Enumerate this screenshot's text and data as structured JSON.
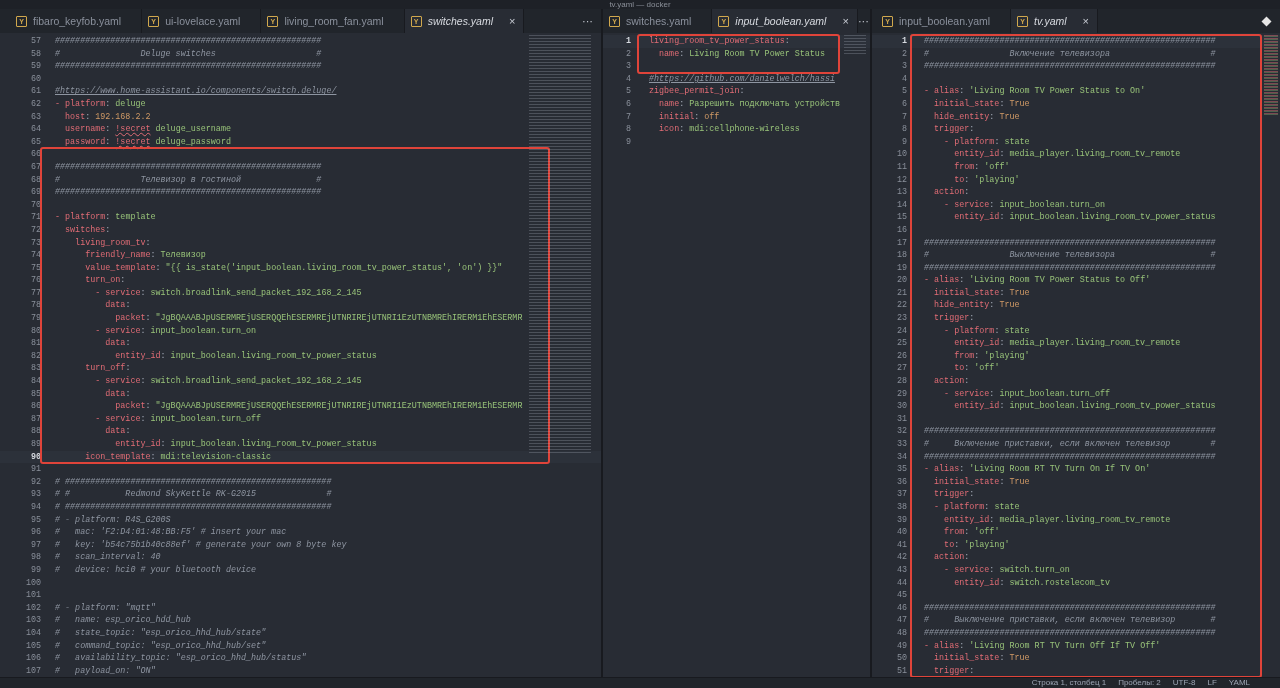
{
  "window": {
    "title": "tv.yaml — docker"
  },
  "panes": [
    {
      "tabs": [
        {
          "badge": "Y",
          "label": "fibaro_keyfob.yaml",
          "selected": false
        },
        {
          "badge": "Y",
          "label": "ui-lovelace.yaml",
          "selected": false
        },
        {
          "badge": "Y",
          "label": "living_room_fan.yaml",
          "selected": false
        },
        {
          "badge": "Y",
          "label": "switches.yaml",
          "selected": true,
          "close": "×"
        }
      ],
      "more": "···",
      "blocks": [
        {
          "boxed": false,
          "lines": [
            {
              "n": "57",
              "kind": "comment",
              "text": "#####################################################",
              "current": false
            },
            {
              "n": "58",
              "kind": "comment",
              "text": "#                Deluge switches                    #",
              "current": false
            },
            {
              "n": "59",
              "kind": "comment",
              "text": "#####################################################",
              "current": false
            },
            {
              "n": "60",
              "kind": "blank",
              "current": false
            },
            {
              "n": "61",
              "kind": "link",
              "text": "#https://www.home-assistant.io/components/switch.deluge/",
              "current": false
            },
            {
              "n": "62",
              "kind": "code",
              "lead": "- ",
              "key": "platform",
              "sep": ": ",
              "value": "deluge",
              "current": false
            },
            {
              "n": "63",
              "kind": "code",
              "key": "  host",
              "sep": ": ",
              "value": "192.168.2.2",
              "const": true,
              "current": false
            },
            {
              "n": "64",
              "kind": "code",
              "key": "  username",
              "sep": ": ",
              "tag": "!secret",
              "value": " deluge_username",
              "current": false
            },
            {
              "n": "65",
              "kind": "code",
              "key": "  password",
              "sep": ": ",
              "tag": "!secret",
              "value": " deluge_password",
              "current": false
            }
          ]
        },
        {
          "boxed": true,
          "lines": [
            {
              "n": "66",
              "kind": "blank",
              "current": false
            },
            {
              "n": "67",
              "kind": "comment",
              "text": "#####################################################",
              "current": false
            },
            {
              "n": "68",
              "kind": "comment",
              "text": "#                Телевизор в гостиной               #",
              "current": false
            },
            {
              "n": "69",
              "kind": "comment",
              "text": "#####################################################",
              "current": false
            },
            {
              "n": "70",
              "kind": "blank",
              "current": false
            },
            {
              "n": "71",
              "kind": "code",
              "lead": "- ",
              "key": "platform",
              "sep": ": ",
              "value": "template",
              "current": false
            },
            {
              "n": "72",
              "kind": "code",
              "key": "  switches",
              "sep": ":",
              "current": false
            },
            {
              "n": "73",
              "kind": "code",
              "key": "    living_room_tv",
              "sep": ":",
              "current": false
            },
            {
              "n": "74",
              "kind": "code",
              "key": "      friendly_name",
              "sep": ": ",
              "value": "Телевизор",
              "current": false
            },
            {
              "n": "75",
              "kind": "code",
              "key": "      value_template",
              "sep": ": ",
              "value": "\"{{ is_state('input_boolean.living_room_tv_power_status', 'on') }}\"",
              "current": false
            },
            {
              "n": "76",
              "kind": "code",
              "key": "      turn_on",
              "sep": ":",
              "current": false
            },
            {
              "n": "77",
              "kind": "code",
              "lead": "        - ",
              "key": "service",
              "sep": ": ",
              "value": "switch.broadlink_send_packet_192_168_2_145",
              "current": false
            },
            {
              "n": "78",
              "kind": "code",
              "key": "          data",
              "sep": ":",
              "current": false
            },
            {
              "n": "79",
              "kind": "code",
              "key": "            packet",
              "sep": ": ",
              "value": "\"JgBQAAABJpUSERMREjUSERQQEhESERMREjUTNRIREjUTNRI1EzUTNBMREhIRERM1EhESERMR",
              "current": false
            },
            {
              "n": "80",
              "kind": "code",
              "lead": "        - ",
              "key": "service",
              "sep": ": ",
              "value": "input_boolean.turn_on",
              "current": false
            },
            {
              "n": "81",
              "kind": "code",
              "key": "          data",
              "sep": ":",
              "current": false
            },
            {
              "n": "82",
              "kind": "code",
              "key": "            entity_id",
              "sep": ": ",
              "value": "input_boolean.living_room_tv_power_status",
              "current": false
            },
            {
              "n": "83",
              "kind": "code",
              "key": "      turn_off",
              "sep": ":",
              "current": false
            },
            {
              "n": "84",
              "kind": "code",
              "lead": "        - ",
              "key": "service",
              "sep": ": ",
              "value": "switch.broadlink_send_packet_192_168_2_145",
              "current": false
            },
            {
              "n": "85",
              "kind": "code",
              "key": "          data",
              "sep": ":",
              "current": false
            },
            {
              "n": "86",
              "kind": "code",
              "key": "            packet",
              "sep": ": ",
              "value": "\"JgBQAAABJpUSERMREjUSERQQEhESERMREjUTNRIREjUTNRI1EzUTNBMREhIRERM1EhESERMR",
              "current": false
            },
            {
              "n": "87",
              "kind": "code",
              "lead": "        - ",
              "key": "service",
              "sep": ": ",
              "value": "input_boolean.turn_off",
              "current": false
            },
            {
              "n": "88",
              "kind": "code",
              "key": "          data",
              "sep": ":",
              "current": false
            },
            {
              "n": "89",
              "kind": "code",
              "key": "            entity_id",
              "sep": ": ",
              "value": "input_boolean.living_room_tv_power_status",
              "current": false
            },
            {
              "n": "90",
              "kind": "code",
              "key": "      icon_template",
              "sep": ": ",
              "value": "mdi:television-classic",
              "current": true
            }
          ]
        },
        {
          "boxed": false,
          "lines": [
            {
              "n": "91",
              "kind": "blank",
              "current": false
            },
            {
              "n": "92",
              "kind": "comment",
              "text": "# #####################################################",
              "current": false
            },
            {
              "n": "93",
              "kind": "comment",
              "text": "# #           Redmond SkyKettle RK-G2015              #",
              "current": false
            },
            {
              "n": "94",
              "kind": "comment",
              "text": "# #####################################################",
              "current": false
            },
            {
              "n": "95",
              "kind": "comment",
              "text": "# - platform: R4S_G200S",
              "current": false
            },
            {
              "n": "96",
              "kind": "comment",
              "text": "#   mac: 'F2:D4:01:48:BB:F5' # insert your mac",
              "current": false
            },
            {
              "n": "97",
              "kind": "comment",
              "text": "#   key: 'b54c75b1b40c88ef' # generate your own 8 byte key",
              "current": false
            },
            {
              "n": "98",
              "kind": "comment",
              "text": "#   scan_interval: 40",
              "current": false
            },
            {
              "n": "99",
              "kind": "comment",
              "text": "#   device: hci0 # your bluetooth device",
              "current": false
            },
            {
              "n": "100",
              "kind": "blank",
              "current": false
            },
            {
              "n": "101",
              "kind": "blank",
              "current": false
            },
            {
              "n": "102",
              "kind": "comment",
              "text": "# - platform: \"mqtt\"",
              "current": false
            },
            {
              "n": "103",
              "kind": "comment",
              "text": "#   name: esp_orico_hdd_hub",
              "current": false
            },
            {
              "n": "104",
              "kind": "comment",
              "text": "#   state_topic: \"esp_orico_hhd_hub/state\"",
              "current": false
            },
            {
              "n": "105",
              "kind": "comment",
              "text": "#   command_topic: \"esp_orico_hhd_hub/set\"",
              "current": false
            },
            {
              "n": "106",
              "kind": "comment",
              "text": "#   availability_topic: \"esp_orico_hhd_hub/status\"",
              "current": false
            },
            {
              "n": "107",
              "kind": "comment",
              "text": "#   payload_on: \"ON\"",
              "current": false
            }
          ]
        }
      ]
    },
    {
      "tabs": [
        {
          "badge": "Y",
          "label": "switches.yaml",
          "selected": false
        },
        {
          "badge": "Y",
          "label": "input_boolean.yaml",
          "selected": true,
          "close": "×"
        }
      ],
      "more": "···",
      "blocks": [
        {
          "boxed": true,
          "lines": [
            {
              "n": "1",
              "kind": "code",
              "key": "living_room_tv_power_status",
              "sep": ":",
              "current": true
            },
            {
              "n": "2",
              "kind": "code",
              "key": "  name",
              "sep": ": ",
              "value": "Living Room TV Power Status",
              "current": false
            },
            {
              "n": "3",
              "kind": "blank",
              "current": false
            }
          ]
        },
        {
          "boxed": false,
          "lines": [
            {
              "n": "4",
              "kind": "link",
              "text": "#https://github.com/danielwelch/hassi",
              "current": false
            },
            {
              "n": "5",
              "kind": "code",
              "key": "zigbee_permit_join",
              "sep": ":",
              "current": false
            },
            {
              "n": "6",
              "kind": "code",
              "key": "  name",
              "sep": ": ",
              "value": "Разрешить подключать устройств",
              "current": false
            },
            {
              "n": "7",
              "kind": "code",
              "key": "  initial",
              "sep": ": ",
              "value": "off",
              "const": true,
              "current": false
            },
            {
              "n": "8",
              "kind": "code",
              "key": "  icon",
              "sep": ": ",
              "value": "mdi:cellphone-wireless",
              "current": false
            },
            {
              "n": "9",
              "kind": "blank",
              "current": false
            }
          ]
        }
      ]
    },
    {
      "tabs": [
        {
          "badge": "Y",
          "label": "input_boolean.yaml",
          "selected": false
        },
        {
          "badge": "Y",
          "label": "tv.yaml",
          "selected": true,
          "close": "×"
        }
      ],
      "blocks": [
        {
          "boxed": true,
          "lines": [
            {
              "n": "1",
              "kind": "comment",
              "text": "##########################################################",
              "current": true
            },
            {
              "n": "2",
              "kind": "comment",
              "text": "#                Включение телевизора                    #",
              "current": false
            },
            {
              "n": "3",
              "kind": "comment",
              "text": "##########################################################",
              "current": false
            },
            {
              "n": "4",
              "kind": "blank",
              "current": false
            },
            {
              "n": "5",
              "kind": "code",
              "lead": "- ",
              "key": "alias",
              "sep": ": ",
              "value": "'Living Room TV Power Status to On'",
              "current": false
            },
            {
              "n": "6",
              "kind": "code",
              "key": "  initial_state",
              "sep": ": ",
              "value": "True",
              "const": true,
              "current": false
            },
            {
              "n": "7",
              "kind": "code",
              "key": "  hide_entity",
              "sep": ": ",
              "value": "True",
              "const": true,
              "current": false
            },
            {
              "n": "8",
              "kind": "code",
              "key": "  trigger",
              "sep": ":",
              "current": false
            },
            {
              "n": "9",
              "kind": "code",
              "lead": "    - ",
              "key": "platform",
              "sep": ": ",
              "value": "state",
              "current": false
            },
            {
              "n": "10",
              "kind": "code",
              "key": "      entity_id",
              "sep": ": ",
              "value": "media_player.living_room_tv_remote",
              "current": false
            },
            {
              "n": "11",
              "kind": "code",
              "key": "      from",
              "sep": ": ",
              "value": "'off'",
              "current": false
            },
            {
              "n": "12",
              "kind": "code",
              "key": "      to",
              "sep": ": ",
              "value": "'playing'",
              "current": false
            },
            {
              "n": "13",
              "kind": "code",
              "key": "  action",
              "sep": ":",
              "current": false
            },
            {
              "n": "14",
              "kind": "code",
              "lead": "    - ",
              "key": "service",
              "sep": ": ",
              "value": "input_boolean.turn_on",
              "current": false
            },
            {
              "n": "15",
              "kind": "code",
              "key": "      entity_id",
              "sep": ": ",
              "value": "input_boolean.living_room_tv_power_status",
              "current": false
            },
            {
              "n": "16",
              "kind": "blank",
              "current": false
            },
            {
              "n": "17",
              "kind": "comment",
              "text": "##########################################################",
              "current": false
            },
            {
              "n": "18",
              "kind": "comment",
              "text": "#                Выключение телевизора                   #",
              "current": false
            },
            {
              "n": "19",
              "kind": "comment",
              "text": "##########################################################",
              "current": false
            },
            {
              "n": "20",
              "kind": "code",
              "lead": "- ",
              "key": "alias",
              "sep": ": ",
              "value": "'Living Room TV Power Status to Off'",
              "current": false
            },
            {
              "n": "21",
              "kind": "code",
              "key": "  initial_state",
              "sep": ": ",
              "value": "True",
              "const": true,
              "current": false
            },
            {
              "n": "22",
              "kind": "code",
              "key": "  hide_entity",
              "sep": ": ",
              "value": "True",
              "const": true,
              "current": false
            },
            {
              "n": "23",
              "kind": "code",
              "key": "  trigger",
              "sep": ":",
              "current": false
            },
            {
              "n": "24",
              "kind": "code",
              "lead": "    - ",
              "key": "platform",
              "sep": ": ",
              "value": "state",
              "current": false
            },
            {
              "n": "25",
              "kind": "code",
              "key": "      entity_id",
              "sep": ": ",
              "value": "media_player.living_room_tv_remote",
              "current": false
            },
            {
              "n": "26",
              "kind": "code",
              "key": "      from",
              "sep": ": ",
              "value": "'playing'",
              "current": false
            },
            {
              "n": "27",
              "kind": "code",
              "key": "      to",
              "sep": ": ",
              "value": "'off'",
              "current": false
            },
            {
              "n": "28",
              "kind": "code",
              "key": "  action",
              "sep": ":",
              "current": false
            },
            {
              "n": "29",
              "kind": "code",
              "lead": "    - ",
              "key": "service",
              "sep": ": ",
              "value": "input_boolean.turn_off",
              "current": false
            },
            {
              "n": "30",
              "kind": "code",
              "key": "      entity_id",
              "sep": ": ",
              "value": "input_boolean.living_room_tv_power_status",
              "current": false
            },
            {
              "n": "31",
              "kind": "blank",
              "current": false
            },
            {
              "n": "32",
              "kind": "comment",
              "text": "##########################################################",
              "current": false
            },
            {
              "n": "33",
              "kind": "comment",
              "text": "#     Включение приставки, если включен телевизор        #",
              "current": false
            },
            {
              "n": "34",
              "kind": "comment",
              "text": "##########################################################",
              "current": false
            },
            {
              "n": "35",
              "kind": "code",
              "lead": "- ",
              "key": "alias",
              "sep": ": ",
              "value": "'Living Room RT TV Turn On If TV On'",
              "current": false
            },
            {
              "n": "36",
              "kind": "code",
              "key": "  initial_state",
              "sep": ": ",
              "value": "True",
              "const": true,
              "current": false
            },
            {
              "n": "37",
              "kind": "code",
              "key": "  trigger",
              "sep": ":",
              "current": false
            },
            {
              "n": "38",
              "kind": "code",
              "lead": "  - ",
              "key": "platform",
              "sep": ": ",
              "value": "state",
              "current": false
            },
            {
              "n": "39",
              "kind": "code",
              "key": "    entity_id",
              "sep": ": ",
              "value": "media_player.living_room_tv_remote",
              "current": false
            },
            {
              "n": "40",
              "kind": "code",
              "key": "    from",
              "sep": ": ",
              "value": "'off'",
              "current": false
            },
            {
              "n": "41",
              "kind": "code",
              "key": "    to",
              "sep": ": ",
              "value": "'playing'",
              "current": false
            },
            {
              "n": "42",
              "kind": "code",
              "key": "  action",
              "sep": ":",
              "current": false
            },
            {
              "n": "43",
              "kind": "code",
              "lead": "    - ",
              "key": "service",
              "sep": ": ",
              "value": "switch.turn_on",
              "current": false
            },
            {
              "n": "44",
              "kind": "code",
              "key": "      entity_id",
              "sep": ": ",
              "value": "switch.rostelecom_tv",
              "current": false
            },
            {
              "n": "45",
              "kind": "blank",
              "current": false
            },
            {
              "n": "46",
              "kind": "comment",
              "text": "##########################################################",
              "current": false
            },
            {
              "n": "47",
              "kind": "comment",
              "text": "#     Выключение приставки, если включен телевизор       #",
              "current": false
            },
            {
              "n": "48",
              "kind": "comment",
              "text": "##########################################################",
              "current": false
            },
            {
              "n": "49",
              "kind": "code",
              "lead": "- ",
              "key": "alias",
              "sep": ": ",
              "value": "'Living Room RT TV Turn Off If TV Off'",
              "current": false
            },
            {
              "n": "50",
              "kind": "code",
              "key": "  initial_state",
              "sep": ": ",
              "value": "True",
              "const": true,
              "current": false
            },
            {
              "n": "51",
              "kind": "code",
              "key": "  trigger",
              "sep": ":",
              "current": false
            }
          ]
        }
      ]
    }
  ],
  "status_bar": [
    "Строка 1, столбец 1",
    "Пробелы: 2",
    "UTF-8",
    "LF",
    "YAML"
  ]
}
